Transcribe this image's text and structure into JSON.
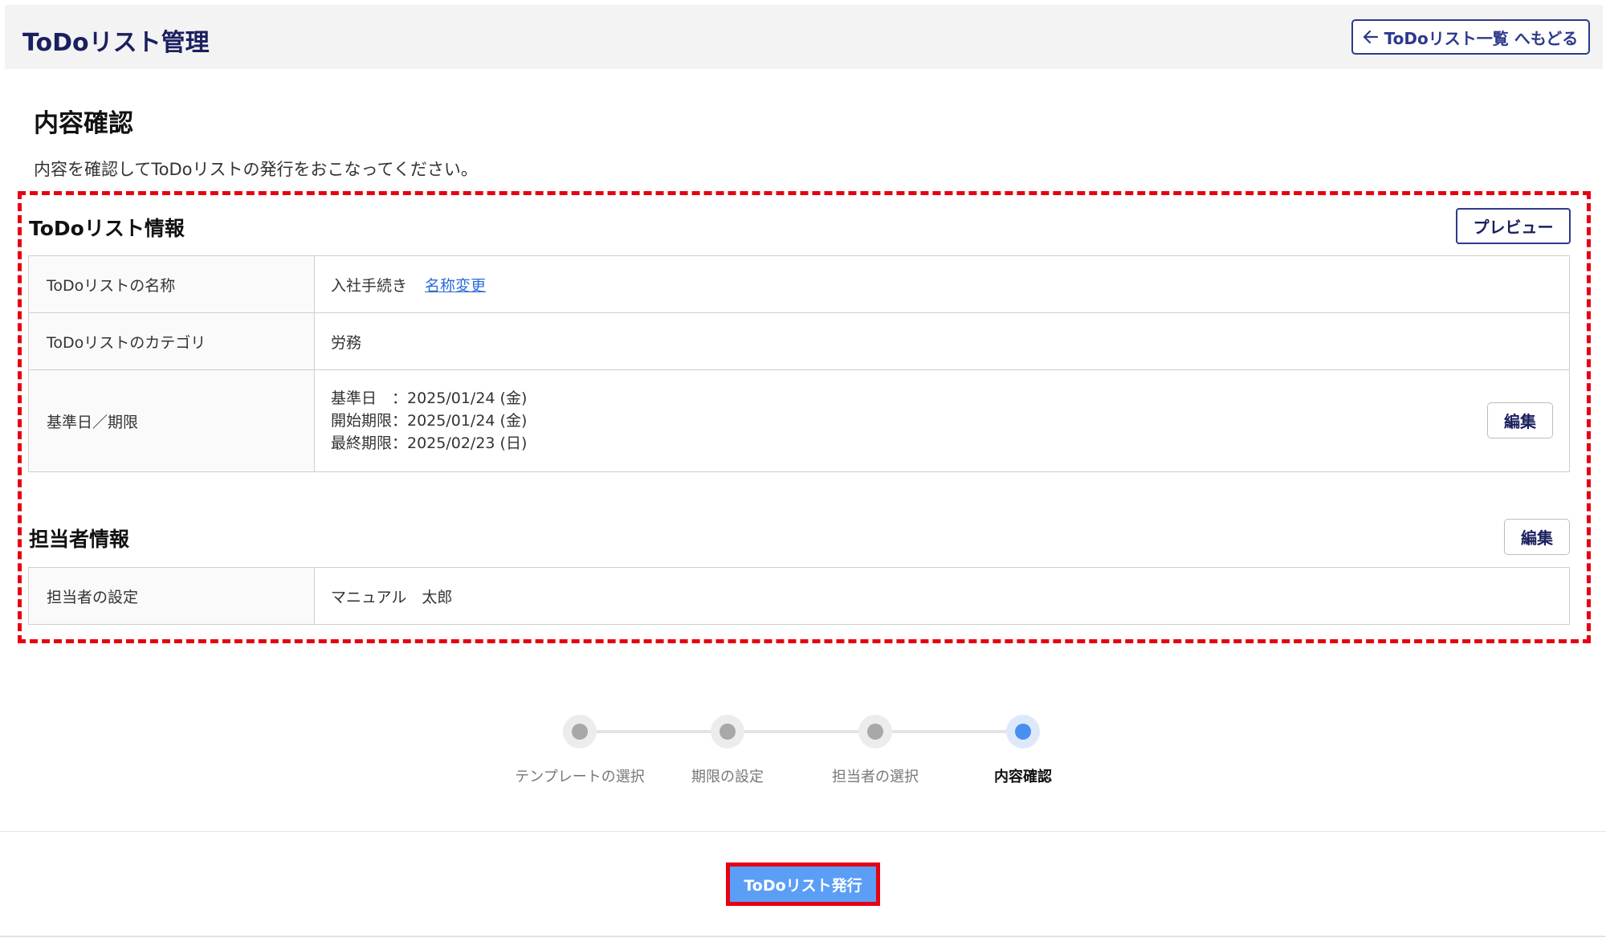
{
  "header": {
    "title": "ToDoリスト管理",
    "back_label": "ToDoリスト一覧 へもどる",
    "back_icon": "arrow-left-icon"
  },
  "page": {
    "title": "内容確認",
    "description": "内容を確認してToDoリストの発行をおこなってください。"
  },
  "todo_info": {
    "title": "ToDoリスト情報",
    "preview_label": "プレビュー",
    "rows": [
      {
        "label": "ToDoリストの名称",
        "value": "入社手続き",
        "link": "名称変更"
      },
      {
        "label": "ToDoリストのカテゴリ",
        "value": "労務"
      },
      {
        "label": "基準日／期限",
        "lines": [
          "基準日　：2025/01/24 (金)",
          "開始期限：2025/01/24 (金)",
          "最終期限：2025/02/23 (日)"
        ],
        "edit_label": "編集"
      }
    ]
  },
  "assignee_info": {
    "title": "担当者情報",
    "edit_label": "編集",
    "rows": [
      {
        "label": "担当者の設定",
        "value": "マニュアル　太郎"
      }
    ]
  },
  "stepper": {
    "steps": [
      {
        "label": "テンプレートの選択",
        "active": false
      },
      {
        "label": "期限の設定",
        "active": false
      },
      {
        "label": "担当者の選択",
        "active": false
      },
      {
        "label": "内容確認",
        "active": true
      }
    ],
    "active_color": "#4a8ff0",
    "inactive_color": "#a8a8a8"
  },
  "footer": {
    "issue_label": "ToDoリスト発行"
  },
  "colors": {
    "brand_navy": "#1a1f5e",
    "highlight_red": "#e60012",
    "primary_button": "#5b9ef5",
    "link": "#2b6cd8"
  }
}
